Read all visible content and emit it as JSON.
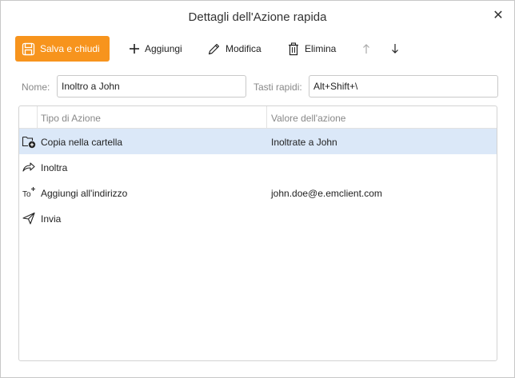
{
  "window": {
    "title": "Dettagli dell'Azione rapida",
    "close_icon": "close-icon",
    "close_glyph": "✕"
  },
  "toolbar": {
    "save_label": "Salva e chiudi",
    "add_label": "Aggiungi",
    "edit_label": "Modifica",
    "delete_label": "Elimina",
    "accent_color": "#f7941d"
  },
  "fields": {
    "name_label": "Nome:",
    "name_value": "Inoltro a John",
    "shortcut_label": "Tasti rapidi:",
    "shortcut_value": "Alt+Shift+\\"
  },
  "table": {
    "columns": [
      "Tipo di Azione",
      "Valore dell'azione"
    ],
    "rows": [
      {
        "icon": "copy-to-folder-icon",
        "type": "Copia nella cartella",
        "value": "Inoltrate a John",
        "selected": true
      },
      {
        "icon": "forward-icon",
        "type": "Inoltra",
        "value": "",
        "selected": false
      },
      {
        "icon": "add-recipient-icon",
        "type": "Aggiungi all'indirizzo",
        "value": "john.doe@e.emclient.com",
        "selected": false
      },
      {
        "icon": "send-icon",
        "type": "Invia",
        "value": "",
        "selected": false
      }
    ],
    "selection_color": "#dbe8f8"
  }
}
